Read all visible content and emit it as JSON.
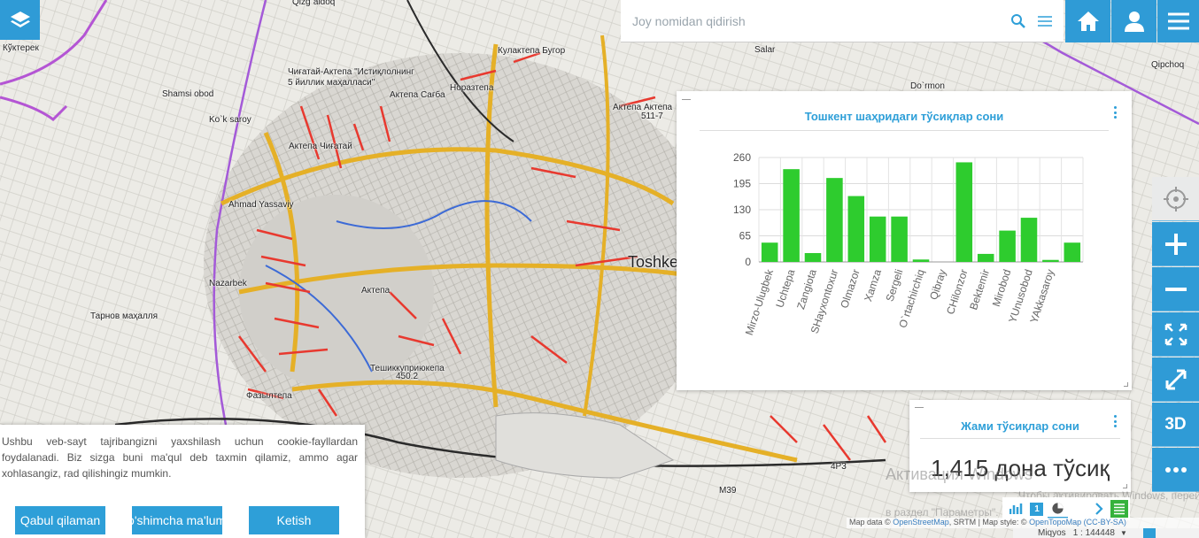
{
  "colors": {
    "accent": "#2f9bd6",
    "bar": "#2ecc2e",
    "title": "#2e9fd8"
  },
  "search": {
    "placeholder": "Joy nomidan qidirish"
  },
  "icons": {
    "layers": "layers-icon",
    "search": "search-icon",
    "list": "list-icon",
    "home": "home-icon",
    "user": "user-icon",
    "menu": "hamburger-menu-icon",
    "locate": "crosshair-icon",
    "zoom_in": "plus-icon",
    "zoom_out": "minus-icon",
    "extent": "full-extent-icon",
    "fullscreen": "expand-icon",
    "more": "dots-icon"
  },
  "buttons": {
    "threed": "3D"
  },
  "map_labels": [
    "Qizg`aldoq",
    "Кўктерек",
    "Shamsi obod",
    "Ko`k saroy",
    "Ahmad Yassaviy",
    "Nazarbek",
    "Тарнов маҳалля",
    "Чиғатай-Актепа \"Истиқлолнинг",
    "5 йиллик маҳалласи\"",
    "Актепа Сағба",
    "Норазтепа",
    "Кулактепа Бугор",
    "Актепа Актепа",
    "511-7",
    "Актепа Чиғатай",
    "Salar",
    "Do`rmon",
    "Qipchoq",
    "Toshkent",
    "Актепа",
    "Тешиккуприюкепа",
    "450.2",
    "Фазылтепа",
    "M39",
    "4Р3"
  ],
  "chart_panel": {
    "title": "Тошкент шаҳридаги тўсиқлар сони"
  },
  "chart_data": {
    "type": "bar",
    "title": "Тошкент шаҳридаги тўсиқлар сони",
    "categories": [
      "Mirzo-Ulugbek",
      "Uchtepa",
      "Zangiota",
      "SHayxontoxur",
      "Olmazor",
      "Xamza",
      "Sergeli",
      "O`rtachirchiq",
      "Qibray",
      "CHilonzor",
      "Bektemir",
      "Mirobod",
      "YUnusobod",
      "YAkkasaroy"
    ],
    "values": [
      48,
      231,
      22,
      209,
      164,
      113,
      113,
      6,
      0,
      248,
      20,
      78,
      110,
      5,
      48
    ],
    "yticks": [
      0,
      65,
      130,
      195,
      260
    ],
    "ylim": [
      0,
      260
    ],
    "grid": true,
    "xlabel": "",
    "ylabel": ""
  },
  "total_panel": {
    "title": "Жами тўсиқлар сони",
    "value": "1,415 дона тўсиқ"
  },
  "cookie": {
    "text": "Ushbu veb-sayt tajribangizni yaxshilash uchun cookie-fayllardan foydalanadi. Biz sizga buni ma'qul deb taxmin qilamiz, ammo agar xohlasangiz, rad qilishingiz mumkin.",
    "accept": "Qabul qilaman",
    "more": "Qo'shimcha ma'lumot",
    "leave": "Ketish"
  },
  "watermark": {
    "line1": "Активация Windows",
    "line2": "Чтобы активировать Windows, перейдите",
    "line3": "в раздел \"Параметры\"."
  },
  "toolbar": {
    "page_number": "1"
  },
  "attribution": {
    "prefix": "Map data ©",
    "osm": "OpenStreetMap",
    "sep": ", SRTM | Map style: ©",
    "style": "OpenTopoMap",
    "license": "(CC-BY-SA)"
  },
  "scale": {
    "label": "Miqyos",
    "value": "1 : 144448"
  }
}
